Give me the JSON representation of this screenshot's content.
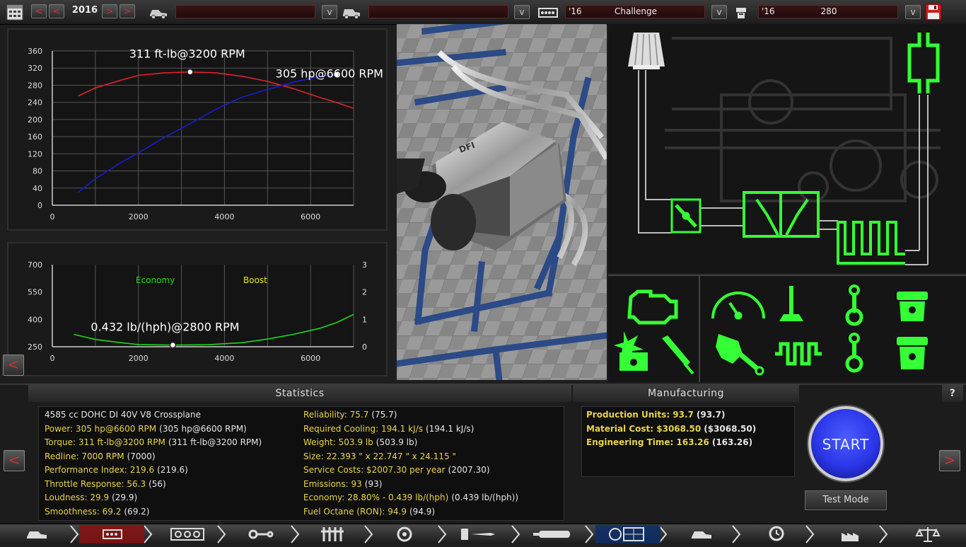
{
  "topbar": {
    "year": "2016",
    "family_field": "",
    "variant_field": "",
    "trim_year": "'16",
    "trim_name": "Challenge",
    "engine_year": "'16",
    "engine_name": "280"
  },
  "power_chart": {
    "torque_annotation": "311 ft-lb@3200 RPM",
    "power_annotation": "305 hp@6600 RPM"
  },
  "chart_data": [
    {
      "type": "line",
      "x": [
        600,
        1000,
        1600,
        2000,
        2600,
        3200,
        3800,
        4400,
        5000,
        5600,
        6200,
        6600,
        7000
      ],
      "series": [
        {
          "values": [
            255,
            274,
            292,
            303,
            309,
            311,
            309,
            301,
            289,
            272,
            252,
            240,
            226
          ],
          "color": "#e0232b"
        },
        {
          "values": [
            30,
            62,
            100,
            122,
            158,
            190,
            224,
            252,
            270,
            287,
            300,
            305,
            null
          ],
          "color": "#1b1bd6"
        }
      ],
      "xlim": [
        0,
        7000
      ],
      "ylim": [
        0,
        360
      ],
      "xticks": [
        "0",
        "2000",
        "4000",
        "6000"
      ],
      "yticks": [
        "0",
        "40",
        "80",
        "120",
        "160",
        "200",
        "240",
        "280",
        "320",
        "360"
      ],
      "annotations": [
        {
          "text": "311 ft-lb@3200 RPM",
          "x": 3200,
          "y": 311
        },
        {
          "text": "305 hp@6600 RPM",
          "x": 6600,
          "y": 305
        }
      ],
      "grid": true
    },
    {
      "type": "line",
      "x": [
        500,
        1000,
        1600,
        2000,
        2800,
        3600,
        4400,
        5000,
        5600,
        6200,
        6600,
        7000
      ],
      "series": [
        {
          "name": "Economy",
          "values": [
            318,
            290,
            272,
            262,
            259,
            261,
            272,
            292,
            318,
            350,
            382,
            427
          ],
          "color": "#1ed81e"
        },
        {
          "name": "Boost",
          "values": [],
          "color": "#e6e61e"
        }
      ],
      "xlim": [
        0,
        7000
      ],
      "ylim": [
        250,
        700
      ],
      "y2lim": [
        0,
        3
      ],
      "xticks": [
        "0",
        "2000",
        "4000",
        "6000"
      ],
      "yticks": [
        "250",
        "400",
        "550",
        "700"
      ],
      "y2ticks": [
        "0",
        "1",
        "2",
        "3"
      ],
      "annotations": [
        {
          "text": "0.432 lb/(hph)@2800 RPM",
          "x": 2800,
          "y": 259
        }
      ],
      "grid": true
    }
  ],
  "economy_chart": {
    "legend_economy": "Economy",
    "legend_boost": "Boost",
    "annotation": "0.432 lb/(hph)@2800 RPM"
  },
  "statistics": {
    "title": "Statistics",
    "left": [
      {
        "label": "4585 cc DOHC DI 40V V8 Crossplane",
        "value": ""
      },
      {
        "label": "Power: 305 hp@6600 RPM",
        "value": "(305 hp@6600 RPM)"
      },
      {
        "label": "Torque: 311 ft-lb@3200 RPM",
        "value": "(311 ft-lb@3200 RPM)"
      },
      {
        "label": "Redline: 7000 RPM",
        "value": "(7000)"
      },
      {
        "label": "Performance Index: 219.6",
        "value": "(219.6)"
      },
      {
        "label": "Throttle Response: 56.3",
        "value": "(56)"
      },
      {
        "label": "Loudness: 29.9",
        "value": "(29.9)"
      },
      {
        "label": "Smoothness: 69.2",
        "value": "(69.2)"
      }
    ],
    "right": [
      {
        "label": "Reliability: 75.7",
        "value": "(75.7)"
      },
      {
        "label": "Required Cooling: 194.1 kJ/s",
        "value": "(194.1 kJ/s)"
      },
      {
        "label": "Weight: 503.9 lb",
        "value": "(503.9 lb)"
      },
      {
        "label": "Size: 22.393 \" x 22.747 \" x 24.115 \"",
        "value": ""
      },
      {
        "label": "Service Costs: $2007.30 per year",
        "value": "(2007.30)"
      },
      {
        "label": "Emissions: 93",
        "value": "(93)"
      },
      {
        "label": "Economy: 28.80% - 0.439 lb/(hph)",
        "value": "(0.439 lb/(hph))"
      },
      {
        "label": "Fuel Octane (RON): 94.9",
        "value": "(94.9)"
      }
    ]
  },
  "manufacturing": {
    "title": "Manufacturing",
    "rows": [
      {
        "label": "Production Units: 93.7",
        "value": "(93.7)"
      },
      {
        "label": "Material Cost: $3068.50",
        "value": "($3068.50)"
      },
      {
        "label": "Engineering Time: 163.26",
        "value": "(163.26)"
      }
    ]
  },
  "actions": {
    "start_label": "START",
    "test_mode_label": "Test Mode",
    "help_label": "?"
  },
  "icons": {
    "schematic": [
      "air-filter-icon",
      "exhaust-muffler-icon",
      "throttle-body-icon",
      "intake-manifold-icon",
      "headers-icon"
    ],
    "parts": [
      "check-engine-icon",
      "gauge-icon",
      "valve-icon",
      "conrod-icon",
      "piston-icon",
      "engine-damage-icon",
      "spark-plug-icon",
      "wrench-hand-icon",
      "crankshaft-icon"
    ]
  },
  "colors": {
    "torque": "#e0232b",
    "power": "#1b1bd6",
    "economy": "#1ed81e",
    "boost": "#e6e61e",
    "stat_yellow": "#e8d44a",
    "schematic_green": "#35ff35",
    "start_blue": "#2b36e8"
  }
}
